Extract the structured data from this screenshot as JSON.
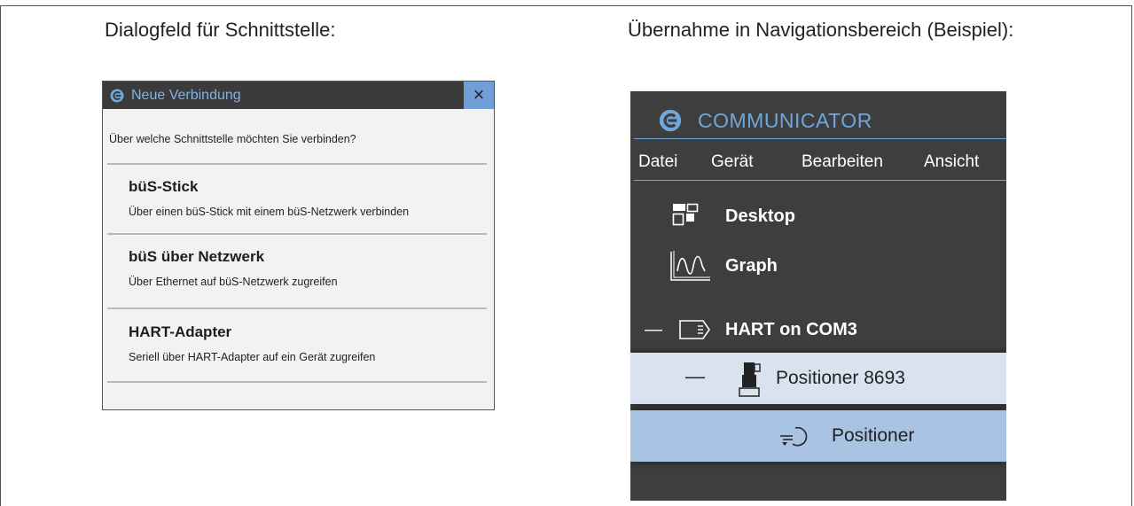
{
  "captions": {
    "left": "Dialogfeld für Schnittstelle:",
    "right": "Übernahme in Navigationsbereich (Beispiel):"
  },
  "dialog": {
    "title": "Neue Verbindung",
    "close_glyph": "×",
    "question": "Über welche Schnittstelle möchten Sie verbinden?",
    "options": [
      {
        "title": "büS-Stick",
        "description": "Über einen büS-Stick mit einem büS-Netzwerk verbinden"
      },
      {
        "title": "büS über Netzwerk",
        "description": "Über Ethernet auf büS-Netzwerk zugreifen"
      },
      {
        "title": "HART-Adapter",
        "description": "Seriell über HART-Adapter auf ein Gerät zugreifen"
      }
    ]
  },
  "navigation": {
    "brand": "COMMUNICATOR",
    "menu": [
      "Datei",
      "Gerät",
      "Bearbeiten",
      "Ansicht"
    ],
    "tree": {
      "desktop": "Desktop",
      "graph": "Graph",
      "connection": "HART on COM3",
      "device": "Positioner 8693",
      "function": "Positioner",
      "collapse_glyph": "—"
    }
  },
  "colors": {
    "accent_blue": "#6fa6dc",
    "panel_dark": "#3e3e3e",
    "close_button": "#6f9fd6",
    "selected_device": "#d9e3f0",
    "selected_function": "#a9c3e2"
  },
  "icons": {
    "dialog_logo": "communicator-logo-icon",
    "close": "close-icon",
    "desktop": "desktop-icon",
    "graph": "graph-icon",
    "connection": "interface-icon",
    "device": "valve-device-icon",
    "function": "positioner-function-icon"
  }
}
